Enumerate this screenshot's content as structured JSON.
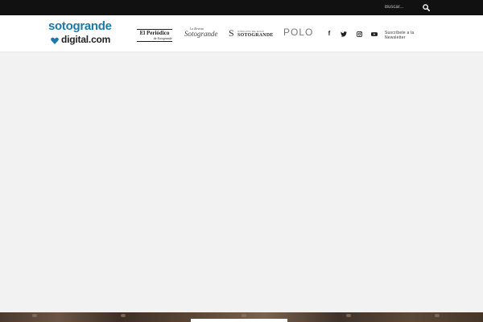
{
  "topbar": {
    "search": {
      "placeholder": "Buscar...",
      "value": ""
    },
    "search_icon": "search-icon"
  },
  "header": {
    "logo": {
      "line1": "sotogrande",
      "line2": "digital.com",
      "mark_icon": "heart-arrow-icon",
      "colors": {
        "primary": "#1c7aa8",
        "secondary": "#222222"
      }
    },
    "publications": [
      {
        "line1": "El Periódico",
        "line2": "de Sotogrande"
      },
      {
        "line1": "La Revista",
        "line2": "Sotogrande"
      },
      {
        "line1": "CIRCUITO DE GOLF",
        "line2": "SOTOGRANDE"
      },
      {
        "line1": "POLO"
      }
    ],
    "social": [
      {
        "icon": "facebook-icon"
      },
      {
        "icon": "twitter-icon"
      },
      {
        "icon": "instagram-icon"
      },
      {
        "icon": "youtube-icon"
      }
    ],
    "newsletter": {
      "line1": "Suscríbete a la",
      "line2": "Newsletter"
    }
  },
  "colors": {
    "topbar": "#111111",
    "header_bg": "#ffffff",
    "content_bg": "#f2f2f2"
  }
}
